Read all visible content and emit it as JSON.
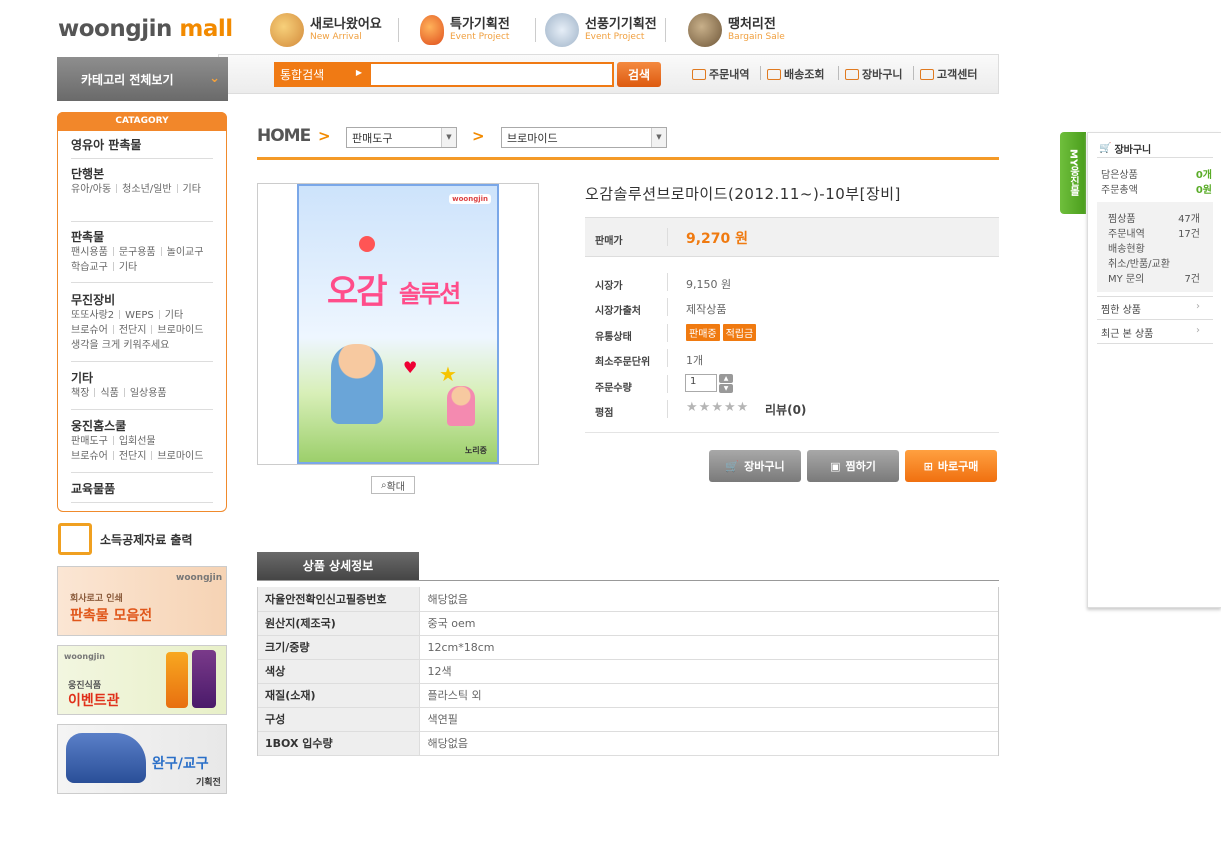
{
  "header": {
    "logo_a": "woongjin",
    "logo_b": "mall",
    "nav": [
      {
        "title": "새로나왔어요",
        "sub": "New Arrival"
      },
      {
        "title": "특가기획전",
        "sub": "Event Project"
      },
      {
        "title": "선풍기기획전",
        "sub": "Event Project"
      },
      {
        "title": "땡처리전",
        "sub": "Bargain Sale"
      }
    ],
    "category_all": "카테고리 전체보기",
    "search_type": "통합검색",
    "search_value": "",
    "search_button": "검색",
    "util": [
      "주문내역",
      "배송조회",
      "장바구니",
      "고객센터"
    ]
  },
  "category": {
    "head": "CATAGORY",
    "groups": [
      {
        "title": "영유아 판촉물",
        "subs": []
      },
      {
        "title": "단행본",
        "subs": [
          [
            "유아/아동",
            "청소년/일반",
            "기타"
          ]
        ]
      },
      {
        "title": "판촉물",
        "subs": [
          [
            "팬시용품",
            "문구용품",
            "놀이교구"
          ],
          [
            "학습교구",
            "기타"
          ]
        ]
      },
      {
        "title": "무진장비",
        "subs": [
          [
            "또또사랑2",
            "WEPS",
            "기타"
          ],
          [
            "브로슈어",
            "전단지",
            "브로마이드"
          ],
          [
            "생각을 크게 키워주세요"
          ]
        ]
      },
      {
        "title": "기타",
        "subs": [
          [
            "책장",
            "식품",
            "일상용품"
          ]
        ]
      },
      {
        "title": "웅진홈스쿨",
        "subs": [
          [
            "판매도구",
            "입회선물"
          ],
          [
            "브로슈어",
            "전단지",
            "브로마이드"
          ]
        ]
      },
      {
        "title": "교육물품",
        "subs": []
      }
    ],
    "tax_print": "소득공제자료 출력",
    "banners": [
      {
        "small": "회사로고 인쇄",
        "big": "판촉물 모음전",
        "brand": "woongjin"
      },
      {
        "small": "웅진식품",
        "big": "이벤트관",
        "brand": "woongjin"
      },
      {
        "big": "완구/교구",
        "small": "기획전"
      }
    ]
  },
  "breadcrumb": {
    "home": "HOME",
    "level1": "판매도구",
    "level2": "브로마이드"
  },
  "product": {
    "title": "오감솔루션브로마이드(2012.11~)-10부[장비]",
    "cover_title_a": "오감",
    "cover_title_b": "솔루션",
    "cover_brand": "woongjin",
    "cover_bottom": "노리중",
    "zoom": "확대",
    "price_label": "판매가",
    "price": "9,270 원",
    "rows": [
      {
        "label": "시장가",
        "value": "9,150 원"
      },
      {
        "label": "시장가출처",
        "value": "제작상품"
      },
      {
        "label": "유통상태",
        "badges": [
          "판매중",
          "적립금"
        ]
      },
      {
        "label": "최소주문단위",
        "value": "1개"
      },
      {
        "label": "주문수량",
        "qty": "1"
      },
      {
        "label": "평점",
        "review": "리뷰(0)",
        "rating": 0
      }
    ],
    "buttons": [
      "장바구니",
      "찜하기",
      "바로구매"
    ]
  },
  "detail": {
    "tab": "상품 상세정보",
    "rows": [
      {
        "k": "자율안전확인신고필증번호",
        "v": "해당없음"
      },
      {
        "k": "원산지(제조국)",
        "v": "중국 oem"
      },
      {
        "k": "크기/중량",
        "v": "12cm*18cm"
      },
      {
        "k": "색상",
        "v": "12색"
      },
      {
        "k": "재질(소재)",
        "v": "플라스틱 외"
      },
      {
        "k": "구성",
        "v": "색연필"
      },
      {
        "k": "1BOX 입수량",
        "v": "해당없음"
      }
    ]
  },
  "my": {
    "tab": "MY웅진몰",
    "cart": "장바구니",
    "cart_items_label": "담은상품",
    "cart_items": "0개",
    "cart_total_label": "주문총액",
    "cart_total": "0원",
    "stats": [
      {
        "k": "찜상품",
        "v": "47개"
      },
      {
        "k": "주문내역",
        "v": "17건"
      },
      {
        "k": "배송현황",
        "v": ""
      },
      {
        "k": "취소/반품/교환",
        "v": ""
      },
      {
        "k": "MY 문의",
        "v": "7건"
      }
    ],
    "links": [
      "찜한 상품",
      "최근 본 상품"
    ]
  },
  "colors": {
    "accent": "#f28a00",
    "green": "#5aac28",
    "gray": "#6a6a6a"
  }
}
